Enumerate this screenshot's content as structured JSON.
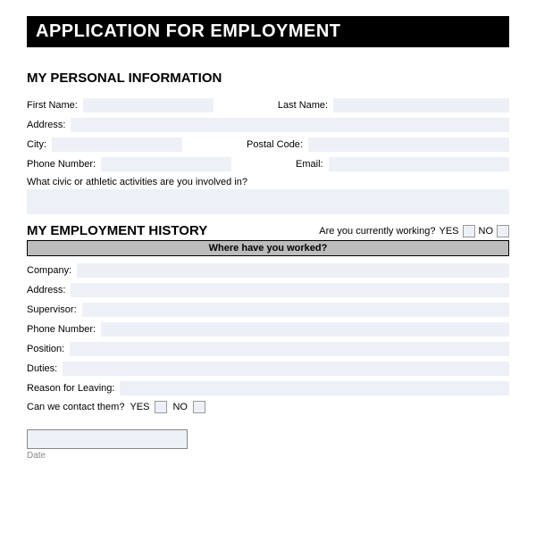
{
  "title": "APPLICATION FOR EMPLOYMENT",
  "personal": {
    "heading": "MY PERSONAL INFORMATION",
    "first_name_label": "First Name:",
    "last_name_label": "Last Name:",
    "address_label": "Address:",
    "city_label": "City:",
    "postal_label": "Postal Code:",
    "phone_label": "Phone Number:",
    "email_label": "Email:",
    "activities_label": "What civic or athletic activities are you involved in?"
  },
  "history": {
    "heading": "MY EMPLOYMENT HISTORY",
    "currently_working_label": "Are you currently working?",
    "yes_label": "YES",
    "no_label": "NO",
    "where_worked_header": "Where have you worked?",
    "company_label": "Company:",
    "address_label": "Address:",
    "supervisor_label": "Supervisor:",
    "phone_label": "Phone Number:",
    "position_label": "Position:",
    "duties_label": "Duties:",
    "reason_label": "Reason for Leaving:",
    "contact_label": "Can we contact them?",
    "contact_yes": "YES",
    "contact_no": "NO"
  },
  "date_label": "Date"
}
